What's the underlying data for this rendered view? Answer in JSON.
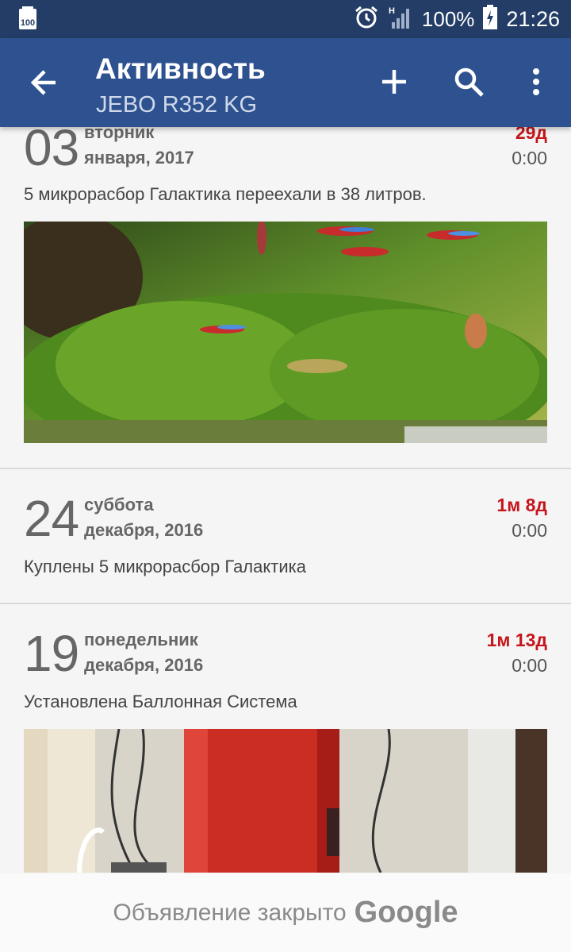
{
  "status_bar": {
    "notification_icon": "battery-100-notification-icon",
    "notification_label": "100",
    "icons": [
      "alarm-icon",
      "signal-icon",
      "battery-charging-icon"
    ],
    "network_label": "H",
    "battery": "100%",
    "time": "21:26"
  },
  "app_bar": {
    "title": "Активность",
    "subtitle": "JEBO R352 KG",
    "actions": [
      "back-icon",
      "add-icon",
      "search-icon",
      "more-vert-icon"
    ]
  },
  "entries": [
    {
      "day": "03",
      "weekday": "вторник",
      "month_year": "января, 2017",
      "age": "29д",
      "time": "0:00",
      "description": "5 микрорасбор Галактика переехали в 38 литров.",
      "photo": "aquarium-fish-photo"
    },
    {
      "day": "24",
      "weekday": "суббота",
      "month_year": "декабря, 2016",
      "age": "1м 8д",
      "time": "0:00",
      "description": "Куплены 5 микрорасбор Галактика"
    },
    {
      "day": "19",
      "weekday": "понедельник",
      "month_year": "декабря, 2016",
      "age": "1м 13д",
      "time": "0:00",
      "description": "Установлена Баллонная Система",
      "photo": "co2-cylinder-photo"
    }
  ],
  "ad": {
    "text": "Объявление закрыто",
    "brand": "Google"
  },
  "colors": {
    "status_bar": "#233d66",
    "app_bar": "#2e5290",
    "age_text": "#c4161c",
    "background": "#f5f5f5"
  }
}
